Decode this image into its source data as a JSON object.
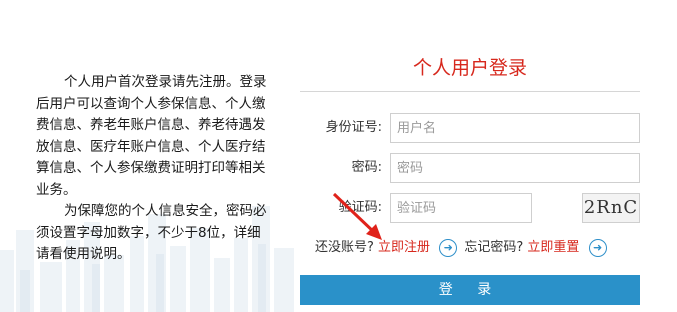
{
  "intro": {
    "paragraph1": "个人用户首次登录请先注册。登录后用户可以查询个人参保信息、个人缴费信息、养老年账户信息、养老待遇发放信息、医疗年账户信息、个人医疗结算信息、个人参保缴费证明打印等相关业务。",
    "paragraph2": "为保障您的个人信息安全，密码必须设置字母加数字，不少于8位，详细请看使用说明。"
  },
  "login": {
    "title": "个人用户登录",
    "id_label": "身份证号:",
    "id_placeholder": "用户名",
    "password_label": "密码:",
    "password_placeholder": "密码",
    "captcha_label": "验证码:",
    "captcha_placeholder": "验证码",
    "captcha_text": "2RnC",
    "no_account_text": "还没账号?",
    "register_link": "立即注册",
    "forgot_text": "忘记密码?",
    "reset_link": "立即重置",
    "login_button": "登 录"
  },
  "colors": {
    "accent_red": "#d7281d",
    "button_blue": "#2a91c9",
    "icon_blue": "#2e8fc9"
  }
}
